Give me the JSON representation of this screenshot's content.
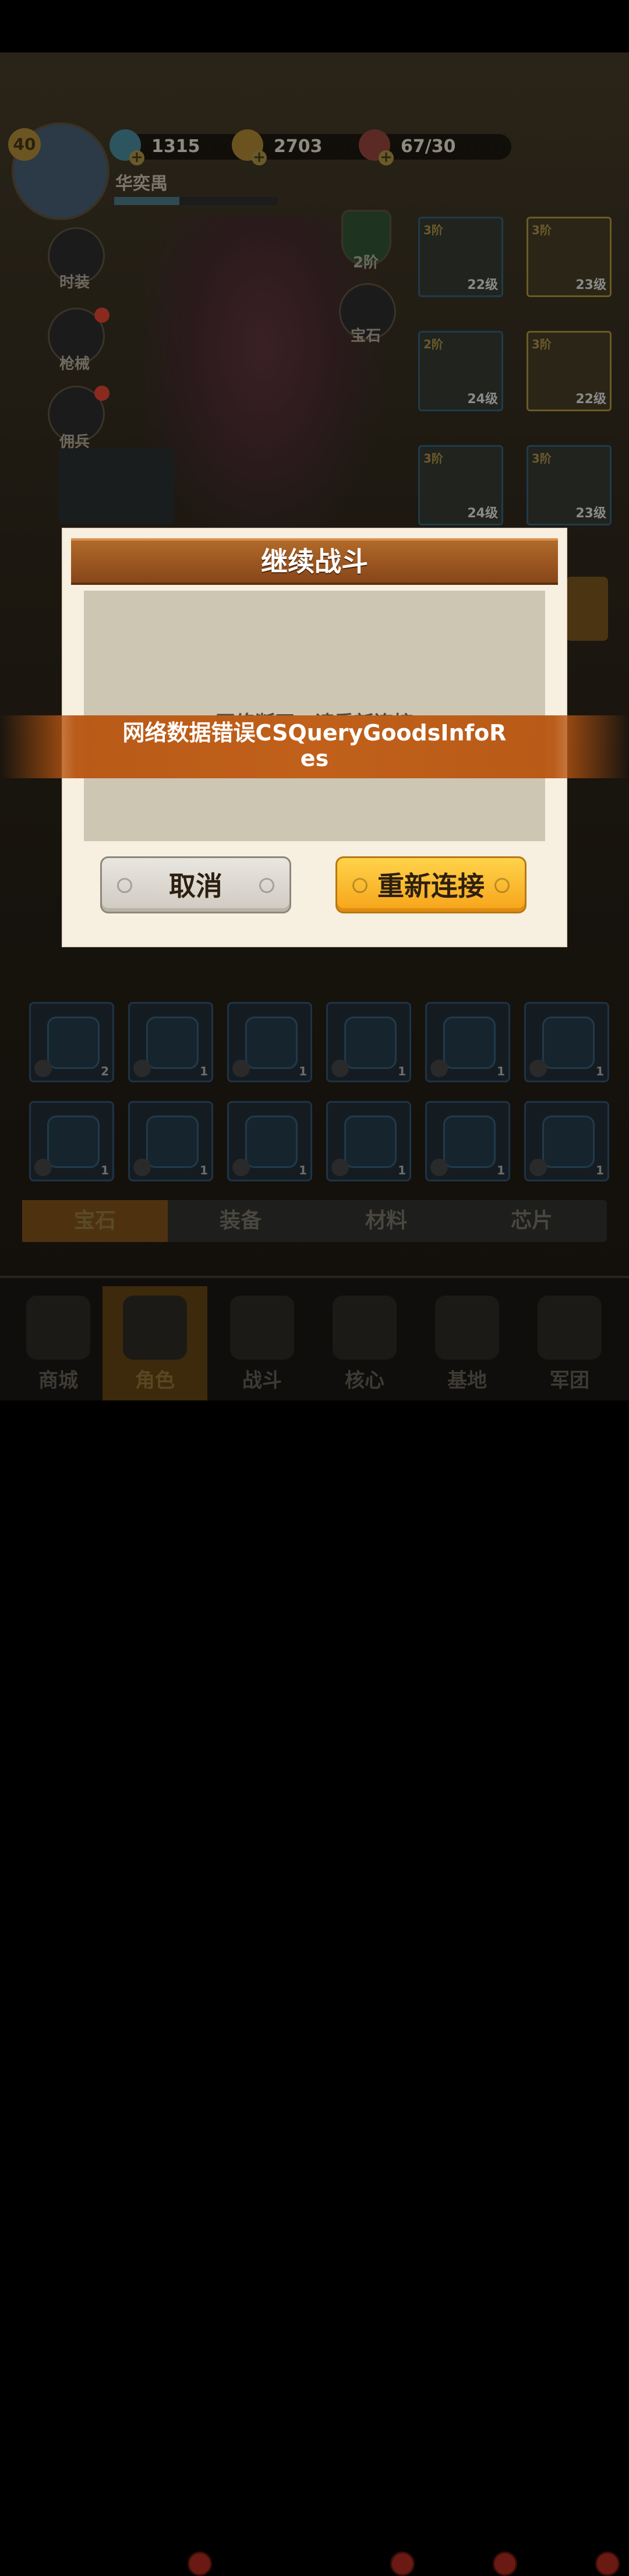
{
  "hud": {
    "level": "40",
    "gems": "1315",
    "coins": "2703",
    "stamina": "67/30",
    "player_name": "华奕禺"
  },
  "side_buttons": [
    "时装",
    "枪械",
    "佣兵"
  ],
  "right_buttons": {
    "rank": "2阶",
    "gem": "宝石"
  },
  "equipment": [
    {
      "tier": "3阶",
      "level": "22级"
    },
    {
      "tier": "3阶",
      "level": "23级"
    },
    {
      "tier": "2阶",
      "level": "24级"
    },
    {
      "tier": "3阶",
      "level": "22级"
    },
    {
      "tier": "3阶",
      "level": "24级"
    },
    {
      "tier": "3阶",
      "level": "23级"
    }
  ],
  "gem_grid_row1_counts": [
    "2",
    "1",
    "1",
    "1",
    "1",
    "1"
  ],
  "gem_grid_row2_counts": [
    "1",
    "1",
    "1",
    "1",
    "1",
    "1"
  ],
  "tabs": [
    "宝石",
    "装备",
    "材料",
    "芯片"
  ],
  "nav": [
    "商城",
    "角色",
    "战斗",
    "核心",
    "基地",
    "军团"
  ],
  "dialog": {
    "title": "继续战斗",
    "message": "网络断开，请重新连接",
    "cancel_label": "取消",
    "reconnect_label": "重新连接"
  },
  "toast": {
    "text": "网络数据错误CSQueryGoodsInfoRes"
  },
  "colors": {
    "dialog_header": "#9a5520",
    "reconnect_button": "#f6a41a",
    "toast": "#c0601a"
  }
}
